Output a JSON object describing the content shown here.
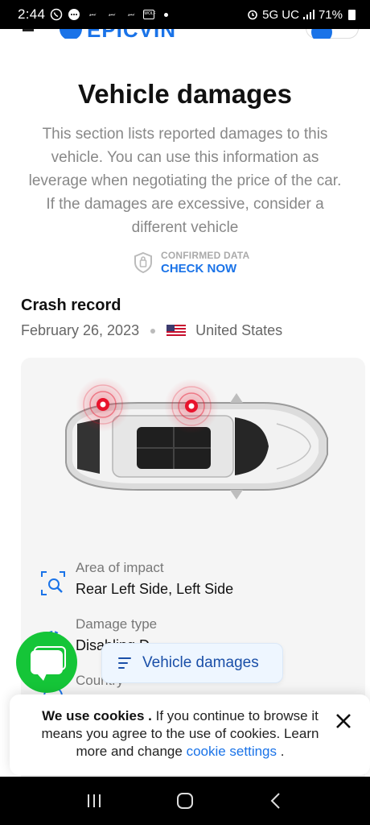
{
  "status_bar": {
    "time": "2:44",
    "mini_label_1": "تيمو",
    "mini_label_2": "تيمو",
    "mini_label_3": "تيمو",
    "mini_label_4": "WOLF",
    "network": "5G UC",
    "battery": "71%"
  },
  "page": {
    "title": "Vehicle damages",
    "description": "This section lists reported damages to this vehicle. You can use this information as leverage when negotiating the price of the car. If the damages are excessive, consider a different vehicle"
  },
  "confirmed": {
    "label": "CONFIRMED DATA",
    "link": "CHECK NOW"
  },
  "crash": {
    "title": "Crash record",
    "date": "February 26, 2023",
    "country": "United States"
  },
  "details": {
    "area_label": "Area of impact",
    "area_value": "Rear Left Side, Left Side",
    "damage_label": "Damage type",
    "damage_value": "Disabling D",
    "country_label": "Country"
  },
  "floating": {
    "section_pill": "Vehicle damages"
  },
  "cookie": {
    "strong": "We use cookies .",
    "text1": " If you continue to browse it means you agree to the use of cookies. Learn more and change ",
    "link": "cookie settings",
    "text2": " ."
  },
  "colors": {
    "accent": "#1a73e8",
    "chat_green": "#15c538",
    "impact_red": "#e8132c"
  }
}
